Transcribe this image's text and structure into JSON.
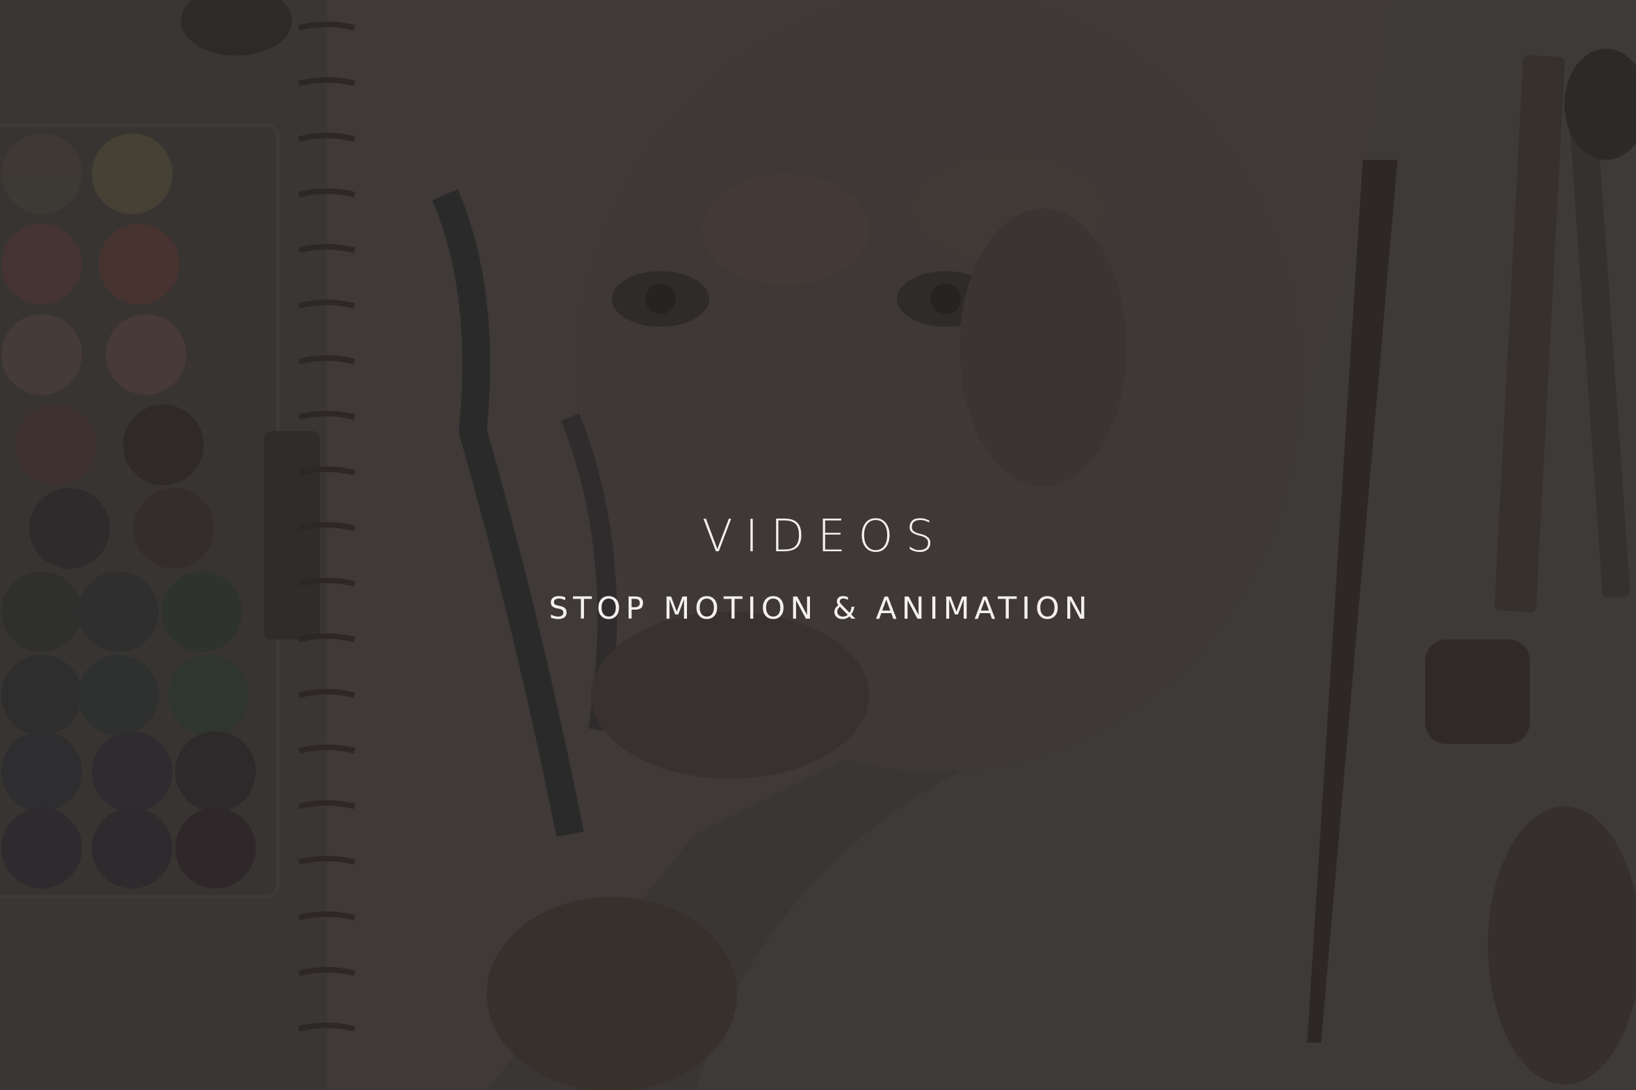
{
  "hero": {
    "title": "VIDEOS",
    "subtitle": "STOP MOTION & ANIMATION",
    "background_image": "artist-desk-photo"
  },
  "colors": {
    "overlay": "#302c2a",
    "text": "#f4f1ee",
    "background": "#413d3b"
  }
}
